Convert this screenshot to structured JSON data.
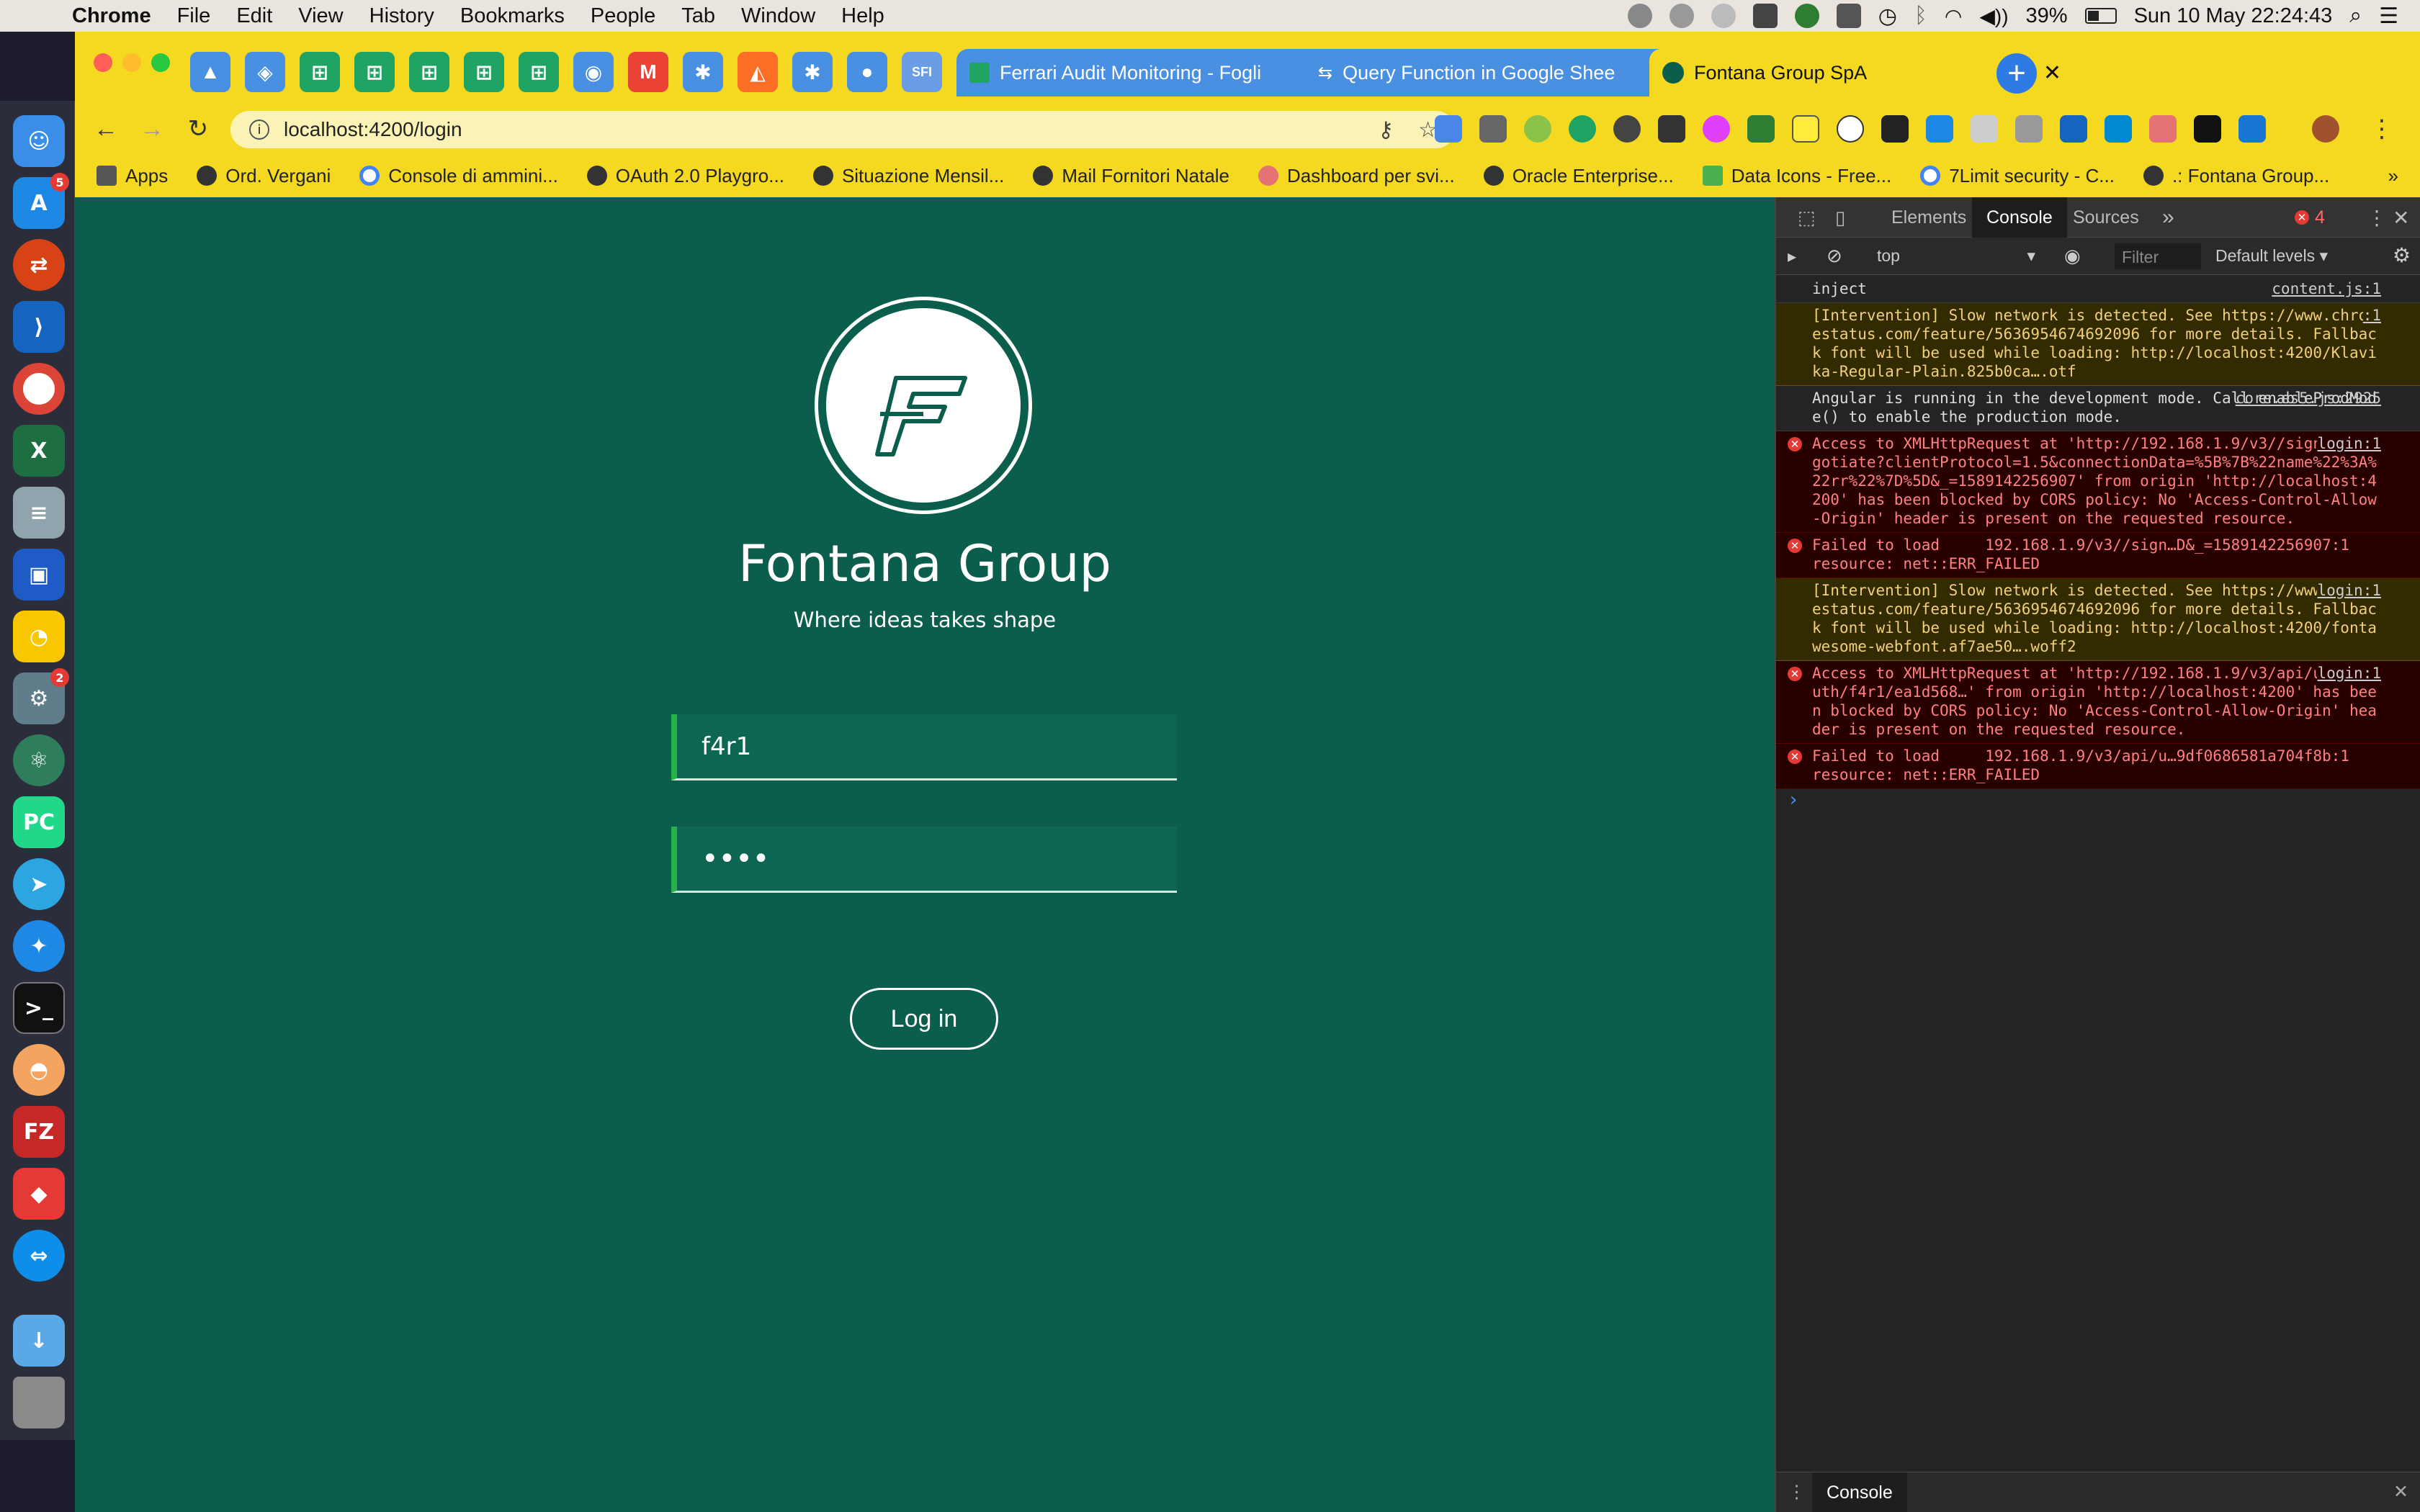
{
  "menubar": {
    "app": "Chrome",
    "items": [
      "File",
      "Edit",
      "View",
      "History",
      "Bookmarks",
      "People",
      "Tab",
      "Window",
      "Help"
    ],
    "battery": "39%",
    "datetime": "Sun 10 May  22:24:43"
  },
  "dock": {
    "badges": {
      "appstore": "5",
      "settings": "2"
    }
  },
  "tabs": {
    "ferrari": "Ferrari Audit Monitoring - Fogli",
    "query": "Query Function in Google Shee",
    "active": "Fontana Group SpA",
    "sfi": "SFI"
  },
  "address": {
    "url": "localhost:4200/login"
  },
  "bookmarks": [
    "Apps",
    "Ord. Vergani",
    "Console di ammini...",
    "OAuth 2.0 Playgro...",
    "Situazione Mensil...",
    "Mail Fornitori Natale",
    "Dashboard per svi...",
    "Oracle Enterprise...",
    "Data Icons - Free...",
    "7Limit security - C...",
    ".: Fontana Group..."
  ],
  "bookmarks_more": "»",
  "login": {
    "brand": "Fontana Group",
    "tagline": "Where ideas takes shape",
    "username": "f4r1",
    "password": "••••",
    "button": "Log in"
  },
  "devtools": {
    "tabs": [
      "Elements",
      "Console",
      "Sources"
    ],
    "more": "»",
    "error_count": "4",
    "context": "top",
    "filter_placeholder": "Filter",
    "levels": "Default levels ▾",
    "drawer_tab": "Console",
    "logs": [
      {
        "type": "info",
        "text": "inject",
        "src": "content.js:1"
      },
      {
        "type": "warn",
        "text": "[Intervention] Slow network is detected. See https://www.chromestatus.com/feature/5636954674692096 for more details. Fallback font will be used while loading: http://localhost:4200/Klavika-Regular-Plain.825b0ca….otf",
        "src": ":1"
      },
      {
        "type": "info",
        "text": "Angular is running in the development mode. Call enableProdMode() to enable the production mode.",
        "src": "core.es5.js:2925"
      },
      {
        "type": "err",
        "text": "Access to XMLHttpRequest at 'http://192.168.1.9/v3//signalr/negotiate?clientProtocol=1.5&connectionData=%5B%7B%22name%22%3A%22rr%22%7D%5D&_=1589142256907' from origin 'http://localhost:4200' has been blocked by CORS policy: No 'Access-Control-Allow-Origin' header is present on the requested resource.",
        "src": "login:1"
      },
      {
        "type": "err",
        "text": "Failed to load     192.168.1.9/v3//sign…D&_=1589142256907:1\nresource: net::ERR_FAILED",
        "src": ""
      },
      {
        "type": "warn",
        "text": "[Intervention] Slow network is detected. See https://www.chromestatus.com/feature/5636954674692096 for more details. Fallback font will be used while loading: http://localhost:4200/fontawesome-webfont.af7ae50….woff2",
        "src": "login:1"
      },
      {
        "type": "err",
        "text": "Access to XMLHttpRequest at 'http://192.168.1.9/v3/api/users/auth/f4r1/ea1d568…' from origin 'http://localhost:4200' has been blocked by CORS policy: No 'Access-Control-Allow-Origin' header is present on the requested resource.",
        "src": "login:1"
      },
      {
        "type": "err",
        "text": "Failed to load     192.168.1.9/v3/api/u…9df0686581a704f8b:1\nresource: net::ERR_FAILED",
        "src": ""
      }
    ],
    "prompt": "›"
  }
}
